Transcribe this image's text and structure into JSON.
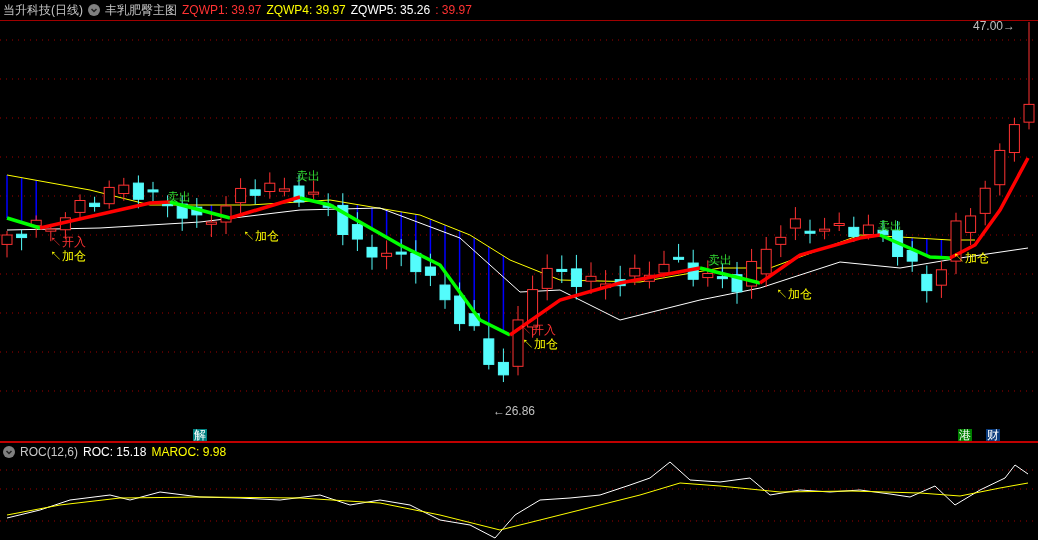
{
  "header": {
    "stock": "当升科技(日线)",
    "indicator_name": "丰乳肥臀主图",
    "values": [
      {
        "text": "ZQWP1: 39.97",
        "color": "#ff3232"
      },
      {
        "text": "ZQWP4: 39.97",
        "color": "#ffff00"
      },
      {
        "text": "ZQWP5: 35.26",
        "color": "#ffffff"
      },
      {
        "text": ": 39.97",
        "color": "#ff3232"
      }
    ]
  },
  "price_chart": {
    "annotations": [
      {
        "kind": "buy",
        "text": "↖开入"
      },
      {
        "kind": "add",
        "text": "↖加仓"
      },
      {
        "kind": "sell",
        "text": "卖出"
      },
      {
        "kind": "add",
        "text": "↖加仓"
      },
      {
        "kind": "sell",
        "text": "卖出"
      },
      {
        "kind": "buy",
        "text": "↖开入"
      },
      {
        "kind": "add",
        "text": "↖加仓"
      },
      {
        "kind": "sell",
        "text": "卖出"
      },
      {
        "kind": "add",
        "text": "↖加仓"
      },
      {
        "kind": "sell",
        "text": "卖出"
      },
      {
        "kind": "add",
        "text": "↖加仓"
      },
      {
        "kind": "price",
        "text": "47.00→"
      },
      {
        "kind": "price",
        "text": "←26.86"
      }
    ],
    "event_tags": [
      {
        "text": "解",
        "color": "#008080"
      },
      {
        "text": "港",
        "color": "#008000"
      },
      {
        "text": "财",
        "color": "#0a3a7a"
      }
    ]
  },
  "sub_chart": {
    "title": "ROC(12,6)",
    "values": [
      {
        "text": "ROC: 15.18",
        "color": "#ffffff"
      },
      {
        "text": "MAROC: 9.98",
        "color": "#ffff00"
      }
    ]
  }
}
